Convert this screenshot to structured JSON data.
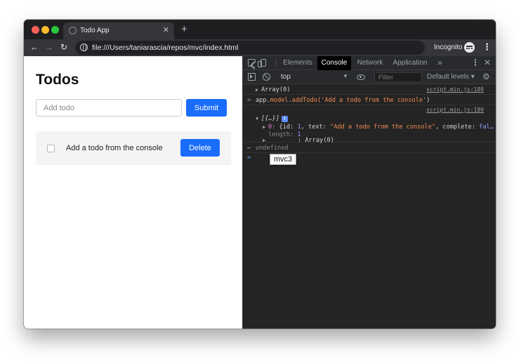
{
  "browser": {
    "tab_title": "Todo App",
    "tab_close": "✕",
    "new_tab": "+",
    "back": "←",
    "forward": "→",
    "reload": "↻",
    "url": "file:///Users/taniarascia/repos/mvc/index.html",
    "incognito_label": "Incognito",
    "menu": "⋮",
    "colors": {
      "red": "#fe5f57",
      "yellow": "#febc2e",
      "green": "#28c840"
    }
  },
  "page": {
    "title": "Todos",
    "input_placeholder": "Add todo",
    "submit_label": "Submit",
    "todos": [
      {
        "text": "Add a todo from the console",
        "completed": false,
        "delete_label": "Delete"
      }
    ],
    "accent": "#1a6dfb"
  },
  "devtools": {
    "tabs": [
      {
        "label": "Elements",
        "active": false
      },
      {
        "label": "Console",
        "active": true
      },
      {
        "label": "Network",
        "active": false
      },
      {
        "label": "Application",
        "active": false
      }
    ],
    "more_tabs": "»",
    "menu": "⋮",
    "close": "✕",
    "context": "top",
    "context_caret": "▼",
    "filter_placeholder": "Filter",
    "levels_label": "Default levels ▾",
    "gear": "⚙",
    "console": {
      "line1": {
        "text": "Array(0)",
        "source": "script.min.js:189"
      },
      "line2": {
        "prompt": ">",
        "obj": "app",
        "dot1": ".",
        "prop": "model",
        "dot2": ".",
        "method": "addTodo(",
        "arg": "'Add a todo from the console'",
        "close": ")"
      },
      "line3": {
        "source": "script.min.js:189",
        "summary": "[{…}]",
        "info": "i",
        "item_index": "0:",
        "item_open": "{id:",
        "item_id": "1",
        "item_text_key": ", text:",
        "item_text": "\"Add a todo from the console\"",
        "item_complete_key": ", complete:",
        "item_complete": "fal…",
        "length_label": "length:",
        "length_value": "1",
        "proto": ": Array(0)"
      },
      "tooltip": "mvc3",
      "result_prompt": "←",
      "result": "undefined",
      "input_prompt": ">"
    }
  }
}
